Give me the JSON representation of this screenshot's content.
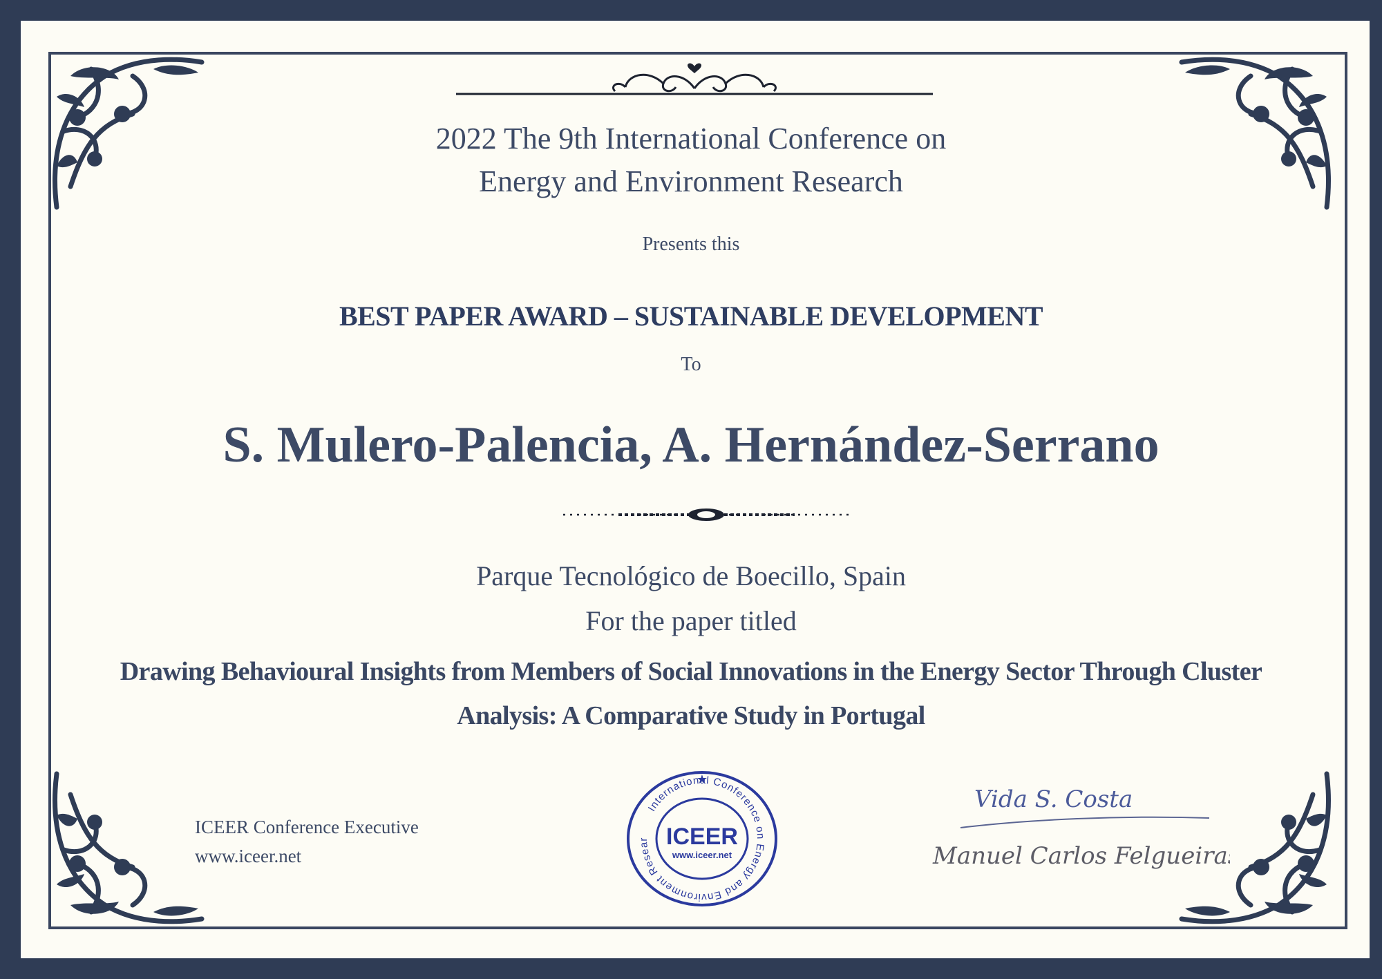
{
  "certificate": {
    "conference_title_line1": "2022 The 9th International Conference on",
    "conference_title_line2": "Energy and Environment Research",
    "presents": "Presents this",
    "award": "BEST PAPER AWARD – SUSTAINABLE DEVELOPMENT",
    "to": "To",
    "recipients": "S. Mulero-Palencia, A. Hernández-Serrano",
    "affiliation": "Parque Tecnológico de Boecillo, Spain",
    "for_paper": "For the paper titled",
    "paper_title_line1": "Drawing Behavioural Insights from Members of Social Innovations in the Energy Sector Through Cluster",
    "paper_title_line2": "Analysis: A Comparative Study in Portugal"
  },
  "footer": {
    "executive": "ICEER Conference Executive",
    "website": "www.iceer.net"
  },
  "seal": {
    "name": "ICEER",
    "url": "www.iceer.net",
    "ring_text": "International Conference on Energy and Environment Research",
    "star": "★"
  },
  "signatures": {
    "line1": "Vida S. Costa",
    "line2": "Manuel Carlos Felgueiras."
  },
  "colors": {
    "border": "#2f3c55",
    "paper": "#fdfcf5",
    "text": "#3d4a66",
    "award": "#2e3d61",
    "seal": "#2b3a9e"
  }
}
